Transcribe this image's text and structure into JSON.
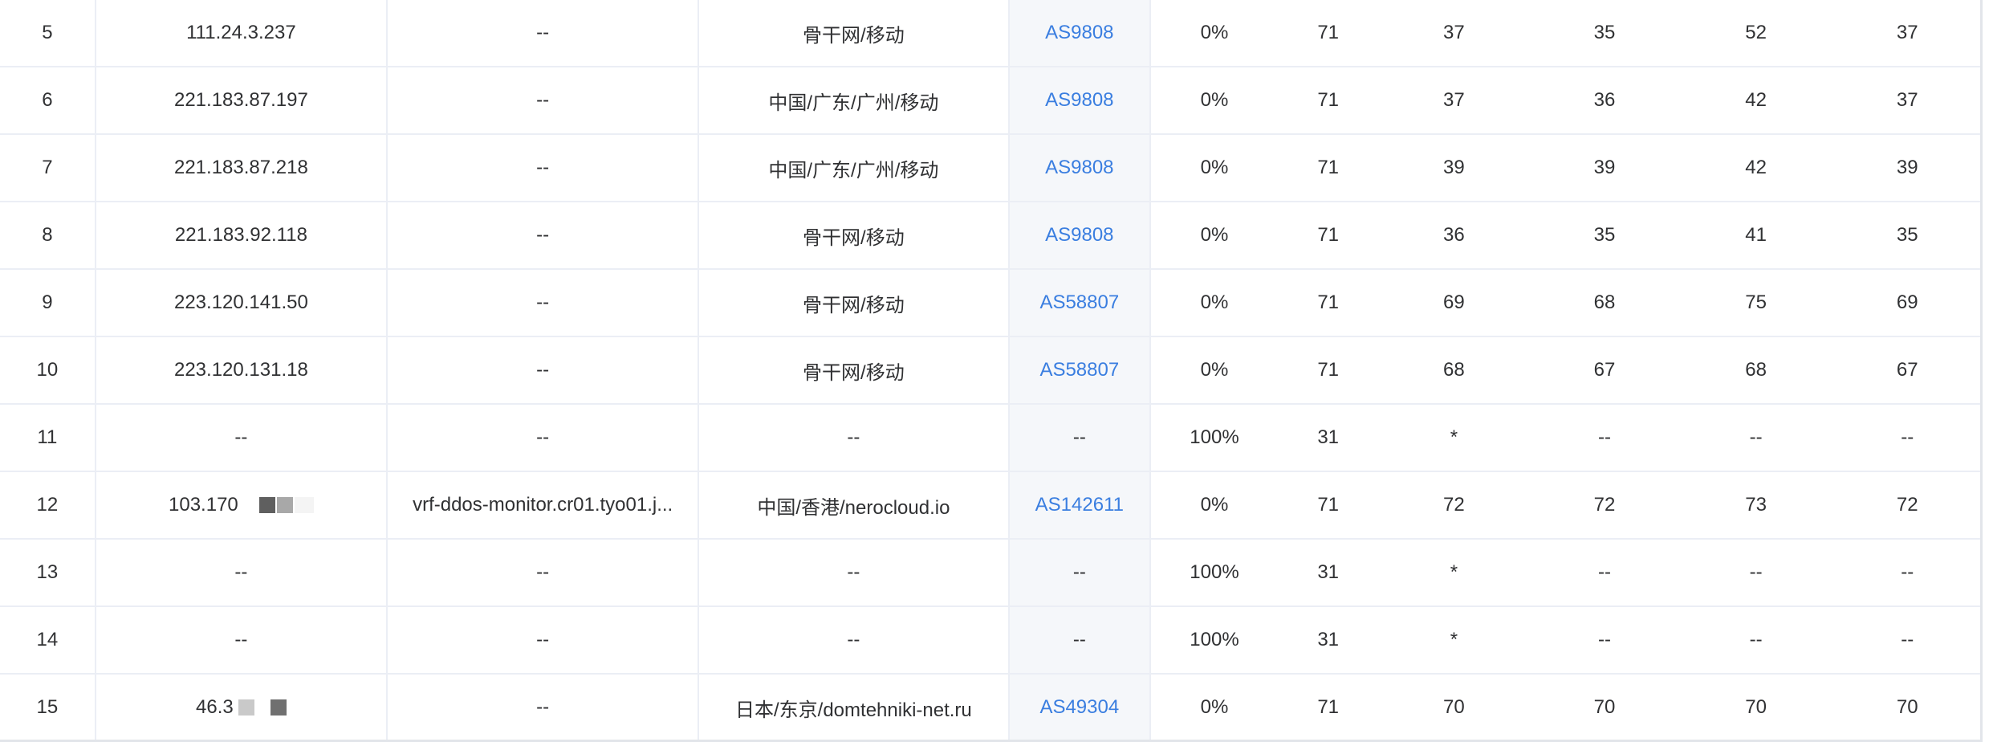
{
  "rows": [
    {
      "no": "5",
      "ip": "111.24.3.237",
      "host": "--",
      "loc": "骨干网/移动",
      "asn": "AS9808",
      "loss": "0%",
      "sent": "71",
      "last": "37",
      "avg": "35",
      "best": "52",
      "worst": "37"
    },
    {
      "no": "6",
      "ip": "221.183.87.197",
      "host": "--",
      "loc": "中国/广东/广州/移动",
      "asn": "AS9808",
      "loss": "0%",
      "sent": "71",
      "last": "37",
      "avg": "36",
      "best": "42",
      "worst": "37"
    },
    {
      "no": "7",
      "ip": "221.183.87.218",
      "host": "--",
      "loc": "中国/广东/广州/移动",
      "asn": "AS9808",
      "loss": "0%",
      "sent": "71",
      "last": "39",
      "avg": "39",
      "best": "42",
      "worst": "39"
    },
    {
      "no": "8",
      "ip": "221.183.92.118",
      "host": "--",
      "loc": "骨干网/移动",
      "asn": "AS9808",
      "loss": "0%",
      "sent": "71",
      "last": "36",
      "avg": "35",
      "best": "41",
      "worst": "35"
    },
    {
      "no": "9",
      "ip": "223.120.141.50",
      "host": "--",
      "loc": "骨干网/移动",
      "asn": "AS58807",
      "loss": "0%",
      "sent": "71",
      "last": "69",
      "avg": "68",
      "best": "75",
      "worst": "69"
    },
    {
      "no": "10",
      "ip": "223.120.131.18",
      "host": "--",
      "loc": "骨干网/移动",
      "asn": "AS58807",
      "loss": "0%",
      "sent": "71",
      "last": "68",
      "avg": "67",
      "best": "68",
      "worst": "67"
    },
    {
      "no": "11",
      "ip": "--",
      "host": "--",
      "loc": "--",
      "asn": "--",
      "loss": "100%",
      "sent": "31",
      "last": "*",
      "avg": "--",
      "best": "--",
      "worst": "--"
    },
    {
      "no": "12",
      "ip": "103.170",
      "host": "vrf-ddos-monitor.cr01.tyo01.j...",
      "loc": "中国/香港/nerocloud.io",
      "asn": "AS142611",
      "loss": "0%",
      "sent": "71",
      "last": "72",
      "avg": "72",
      "best": "73",
      "worst": "72"
    },
    {
      "no": "13",
      "ip": "--",
      "host": "--",
      "loc": "--",
      "asn": "--",
      "loss": "100%",
      "sent": "31",
      "last": "*",
      "avg": "--",
      "best": "--",
      "worst": "--"
    },
    {
      "no": "14",
      "ip": "--",
      "host": "--",
      "loc": "--",
      "asn": "--",
      "loss": "100%",
      "sent": "31",
      "last": "*",
      "avg": "--",
      "best": "--",
      "worst": "--"
    },
    {
      "no": "15",
      "ip": "46.3",
      "host": "--",
      "loc": "日本/东京/domtehniki-net.ru",
      "asn": "AS49304",
      "loss": "0%",
      "sent": "71",
      "last": "70",
      "avg": "70",
      "best": "70",
      "worst": "70"
    }
  ],
  "colors": {
    "link": "#3a7ee0",
    "text": "#303133",
    "border": "#ebeef5",
    "asn_bg": "#f5f7fa"
  }
}
